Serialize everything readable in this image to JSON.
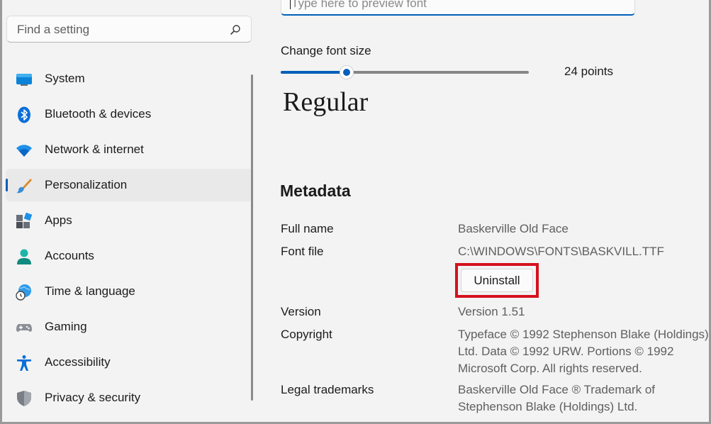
{
  "search": {
    "placeholder": "Find a setting"
  },
  "sidebar": {
    "items": [
      {
        "label": "System",
        "icon": "monitor-icon"
      },
      {
        "label": "Bluetooth & devices",
        "icon": "bluetooth-icon"
      },
      {
        "label": "Network & internet",
        "icon": "wifi-icon"
      },
      {
        "label": "Personalization",
        "icon": "brush-icon",
        "selected": true
      },
      {
        "label": "Apps",
        "icon": "apps-icon"
      },
      {
        "label": "Accounts",
        "icon": "person-icon"
      },
      {
        "label": "Time & language",
        "icon": "globe-clock-icon"
      },
      {
        "label": "Gaming",
        "icon": "gamepad-icon"
      },
      {
        "label": "Accessibility",
        "icon": "accessibility-icon"
      },
      {
        "label": "Privacy & security",
        "icon": "shield-icon"
      }
    ]
  },
  "preview": {
    "placeholder": "Type here to preview font"
  },
  "font_size": {
    "label": "Change font size",
    "value_text": "24 points",
    "fraction": 0.265
  },
  "preview_text": "Regular",
  "metadata": {
    "title": "Metadata",
    "full_name_label": "Full name",
    "full_name_value": "Baskerville Old Face",
    "font_file_label": "Font file",
    "font_file_value": "C:\\WINDOWS\\FONTS\\BASKVILL.TTF",
    "uninstall_label": "Uninstall",
    "version_label": "Version",
    "version_value": "Version 1.51",
    "copyright_label": "Copyright",
    "copyright_lines": [
      "Typeface © 1992 Stephenson Blake (Holdings)",
      "Ltd. Data © 1992 URW. Portions © 1992",
      "Microsoft Corp. All rights reserved."
    ],
    "trademark_label": "Legal trademarks",
    "trademark_lines": [
      "Baskerville Old Face ® Trademark of",
      "Stephenson Blake (Holdings) Ltd."
    ]
  },
  "colors": {
    "accent": "#005fb8",
    "highlight_box": "#d4121e"
  }
}
